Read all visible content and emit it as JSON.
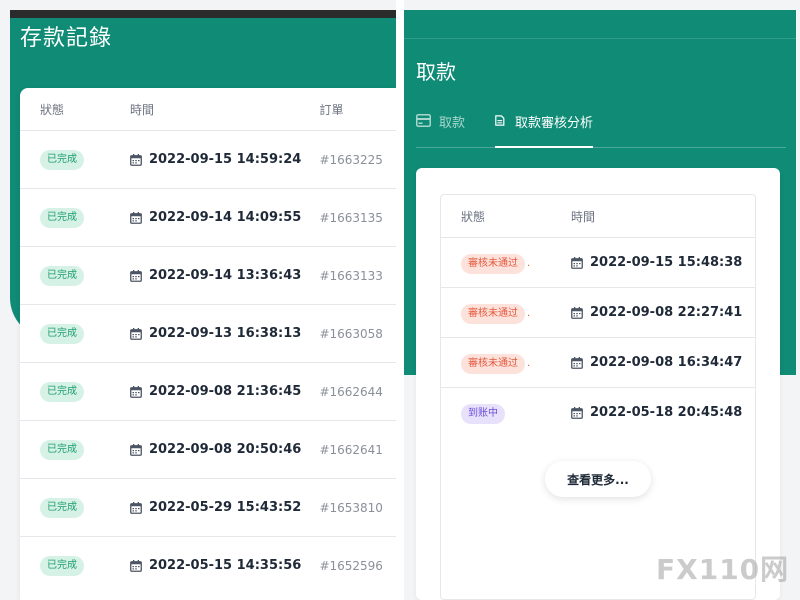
{
  "left": {
    "title": "存款記錄",
    "headers": {
      "status": "狀態",
      "time": "時間",
      "order": "訂單"
    },
    "rows": [
      {
        "status": "已完成",
        "time": "2022-09-15 14:59:24",
        "order": "#1663225"
      },
      {
        "status": "已完成",
        "time": "2022-09-14 14:09:55",
        "order": "#1663135"
      },
      {
        "status": "已完成",
        "time": "2022-09-14 13:36:43",
        "order": "#1663133"
      },
      {
        "status": "已完成",
        "time": "2022-09-13 16:38:13",
        "order": "#1663058"
      },
      {
        "status": "已完成",
        "time": "2022-09-08 21:36:45",
        "order": "#1662644"
      },
      {
        "status": "已完成",
        "time": "2022-09-08 20:50:46",
        "order": "#1662641"
      },
      {
        "status": "已完成",
        "time": "2022-05-29 15:43:52",
        "order": "#1653810"
      },
      {
        "status": "已完成",
        "time": "2022-05-15 14:35:56",
        "order": "#1652596"
      }
    ]
  },
  "right": {
    "title": "取款",
    "tabs": [
      {
        "label": "取款",
        "icon": "card-icon",
        "active": false
      },
      {
        "label": "取款審核分析",
        "icon": "document-icon",
        "active": true
      }
    ],
    "headers": {
      "status": "狀態",
      "time": "時間"
    },
    "rows": [
      {
        "status": "審核未通过",
        "status_type": "fail",
        "dot": ".",
        "time": "2022-09-15 15:48:38"
      },
      {
        "status": "審核未通过",
        "status_type": "fail",
        "dot": ".",
        "time": "2022-09-08 22:27:41"
      },
      {
        "status": "審核未通过",
        "status_type": "fail",
        "dot": ".",
        "time": "2022-09-08 16:34:47"
      },
      {
        "status": "到账中",
        "status_type": "progress",
        "dot": "",
        "time": "2022-05-18 20:45:48"
      }
    ],
    "more_label": "查看更多..."
  },
  "watermark": "FX110网",
  "colors": {
    "primary_green": "#0f8b76",
    "badge_done_bg": "#d6f2e6",
    "badge_fail_bg": "#fde2db",
    "badge_progress_bg": "#e7e1fb"
  }
}
